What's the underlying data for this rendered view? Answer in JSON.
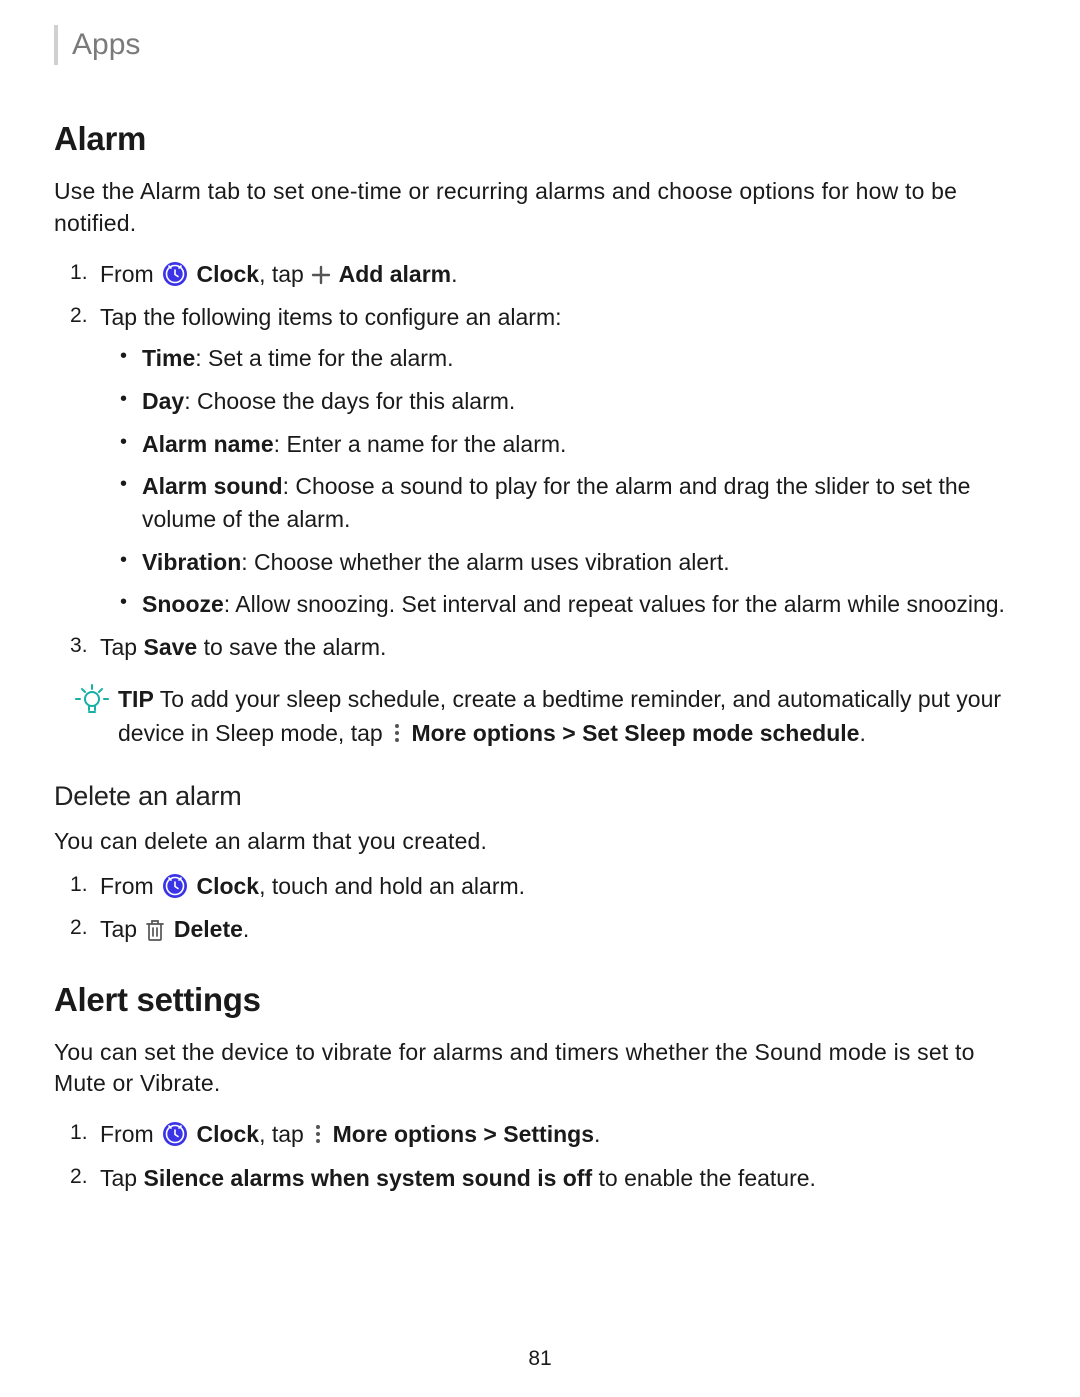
{
  "header": {
    "breadcrumb": "Apps"
  },
  "alarm": {
    "heading": "Alarm",
    "intro": "Use the Alarm tab to set one-time or recurring alarms and choose options for how to be notified.",
    "step1": {
      "pre": "From ",
      "clock_label": "Clock",
      "mid": ", tap ",
      "add_label": "Add alarm",
      "end": "."
    },
    "step2": {
      "intro": "Tap the following items to configure an alarm:",
      "items": [
        {
          "term": "Time",
          "desc": ": Set a time for the alarm."
        },
        {
          "term": "Day",
          "desc": ": Choose the days for this alarm."
        },
        {
          "term": "Alarm name",
          "desc": ": Enter a name for the alarm."
        },
        {
          "term": "Alarm sound",
          "desc": ": Choose a sound to play for the alarm and drag the slider to set the volume of the alarm."
        },
        {
          "term": "Vibration",
          "desc": ": Choose whether the alarm uses vibration alert."
        },
        {
          "term": "Snooze",
          "desc": ": Allow snoozing. Set interval and repeat values for the alarm while snoozing."
        }
      ]
    },
    "step3": {
      "pre": "Tap ",
      "save": "Save",
      "post": " to save the alarm."
    },
    "tip": {
      "label": "TIP",
      "pre": "  To add your sleep schedule, create a bedtime reminder, and automatically put your device in Sleep mode, tap ",
      "more": "More options",
      "gt": " > ",
      "set": "Set Sleep mode schedule",
      "end": "."
    }
  },
  "delete": {
    "heading": "Delete an alarm",
    "intro": "You can delete an alarm that you created.",
    "step1": {
      "pre": "From ",
      "clock_label": "Clock",
      "post": ", touch and hold an alarm."
    },
    "step2": {
      "pre": "Tap ",
      "label": "Delete",
      "end": "."
    }
  },
  "alert": {
    "heading": "Alert settings",
    "intro": "You can set the device to vibrate for alarms and timers whether the Sound mode is set to Mute or Vibrate.",
    "step1": {
      "pre": "From ",
      "clock_label": "Clock",
      "mid": ", tap ",
      "more": "More options",
      "gt": " > ",
      "settings": "Settings",
      "end": "."
    },
    "step2": {
      "pre": "Tap ",
      "bold": "Silence alarms when system sound is off",
      "post": " to enable the feature."
    }
  },
  "page": "81"
}
